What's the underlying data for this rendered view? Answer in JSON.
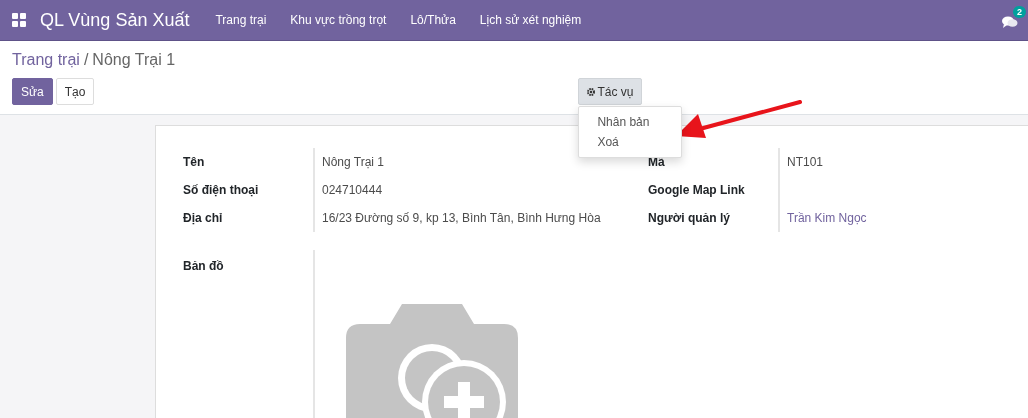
{
  "navbar": {
    "app_title": "QL Vùng Sản Xuất",
    "menu": [
      "Trang trại",
      "Khu vực trồng trọt",
      "Lô/Thửa",
      "Lịch sử xét nghiệm"
    ],
    "message_count": "2"
  },
  "breadcrumb": {
    "parent": "Trang trại",
    "separator": "/",
    "current": "Nông Trại 1"
  },
  "buttons": [
    "Sửa",
    "Tạo"
  ],
  "action_menu": {
    "label": "Tác vụ",
    "expanded": true,
    "items": [
      "Nhân bản",
      "Xoá"
    ]
  },
  "form": {
    "left_fields": [
      {
        "label": "Tên",
        "value": "Nông Trại 1"
      },
      {
        "label": "Số điện thoại",
        "value": "024710444"
      },
      {
        "label": "Địa chỉ",
        "value": "16/23 Đường số 9, kp 13, Bình Tân, Bình Hưng Hòa"
      }
    ],
    "right_fields": [
      {
        "label": "Mã",
        "value": "NT101",
        "kind": "text"
      },
      {
        "label": "Google Map Link",
        "kind": "text"
      },
      {
        "label": "Người quản lý",
        "value": "Trần Kim Ngọc",
        "kind": "link"
      }
    ],
    "map_label": "Bản đồ"
  }
}
